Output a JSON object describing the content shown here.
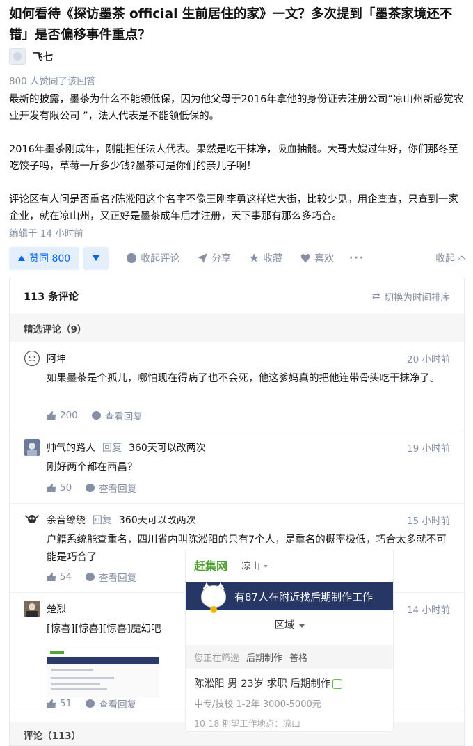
{
  "question": {
    "title": "如何看待《探访墨茶 official 生前居住的家》一文？多次提到「墨茶家境还不错」是否偏移事件重点？"
  },
  "answer": {
    "author_name": "飞七",
    "vote_info": "800 人赞同了该回答",
    "paragraphs": [
      "最新的披露，墨茶为什么不能领低保，因为他父母于2016年拿他的身份证去注册公司“凉山州新感觉农业开发有限公司 ”，法人代表是不能领低保的。",
      "2016年墨茶刚成年，刚能担任法人代表。果然是吃干抹净，吸血抽髓。大哥大嫂过年好，你们那冬至吃饺子吗，草莓一斤多少钱?墨茶可是你们的亲儿子啊！",
      "评论区有人问是否重名?陈淞阳这个名字不像王刚李勇这样烂大街，比较少见。用企查查，只查到一家企业，就在凉山州，又正好是墨茶成年后才注册，天下事那有那么多巧合。"
    ],
    "edited": "编辑于 14 小时前"
  },
  "actions": {
    "upvote_label": "赞同 800",
    "comment_label": "收起评论",
    "share_label": "分享",
    "favorite_label": "收藏",
    "like_label": "喜欢",
    "more_label": "···",
    "collapse_label": "收起"
  },
  "comments": {
    "count_label": "113 条评论",
    "sort_label": "切换为时间排序",
    "featured_label": "精选评论（9）",
    "all_label": "评论（113）",
    "reply_label": "查看回复",
    "reply_word": "回复",
    "items": [
      {
        "name": "阿坤",
        "time": "20 小时前",
        "body": "如果墨茶是个孤儿，哪怕现在得病了也不会死，他这爹妈真的把他连带骨头吃干抹净了。",
        "likes": "200"
      },
      {
        "name": "帅气的路人",
        "target": "360天可以改两次",
        "time": "19 小时前",
        "body": "刚好两个都在西昌？",
        "likes": "50"
      },
      {
        "name": "余音缭绕",
        "target": "360天可以改两次",
        "time": "15 小时前",
        "body": "户籍系统能查重名，四川省内叫陈淞阳的只有7个人，是重名的概率极低，巧合太多就不可能是巧合了",
        "likes": "54"
      },
      {
        "name": "楚烈",
        "time": "14 小时前",
        "body": "[惊喜][惊喜][惊喜]魔幻吧",
        "likes": "51"
      }
    ]
  },
  "ad": {
    "logo": "赶集网",
    "city": "凉山",
    "banner": "有87人在附近找后期制作工作",
    "region": "区域",
    "filter_label": "您正在筛选",
    "filter_1": "后期制作",
    "filter_2": "普格",
    "job": "陈淞阳 男 23岁 求职 后期制作",
    "meta": "中专/技校  1-2年  3000-5000元",
    "date": "10-18  期望工作地点：凉山"
  },
  "colors": {
    "accent": "#0066ff",
    "muted": "#8590a6",
    "ad_green": "#4aa02c",
    "ad_banner": "#263766"
  }
}
